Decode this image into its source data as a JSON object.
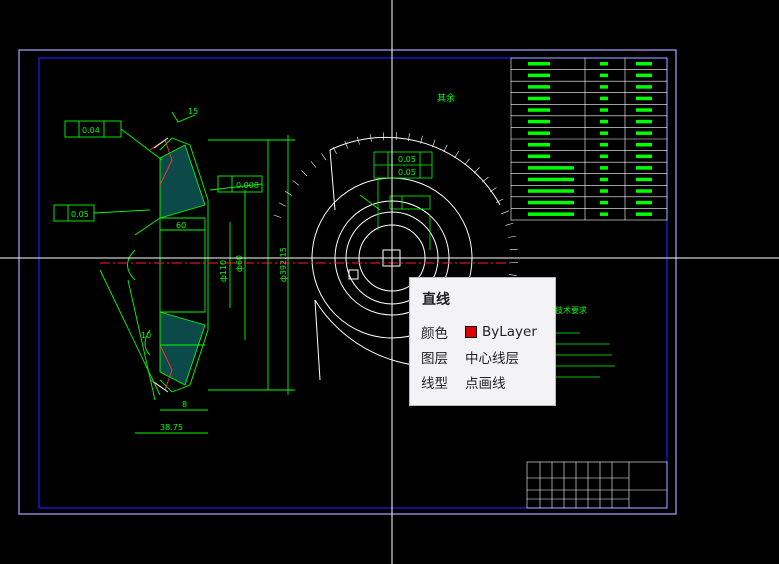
{
  "drawing": {
    "tech_heading": "技术要求",
    "surface_roughness_note": "其余",
    "tol_boxes": [
      {
        "symbol": "↗",
        "value": "0.04",
        "ref": "A"
      },
      {
        "symbol": "↗",
        "value": "0.05",
        "ref": "A"
      },
      {
        "symbol": "◻",
        "value": "0.008"
      },
      {
        "symbol": "⊥",
        "value": "0.05",
        "ref": "A"
      },
      {
        "symbol": "∥",
        "value": "0.05",
        "ref": "A"
      }
    ],
    "dims": [
      "15",
      "60",
      "10",
      "8",
      "38.75",
      "ф110",
      "ф60",
      "ф392.15"
    ]
  },
  "tooltip": {
    "title": "直线",
    "rows": [
      {
        "key": "颜色",
        "value": "ByLayer",
        "color": "#e00000"
      },
      {
        "key": "图层",
        "value": "中心线层"
      },
      {
        "key": "线型",
        "value": "点画线"
      }
    ]
  },
  "colors": {
    "background": "#000000",
    "geometry": "#00ff00",
    "border_outer": "#a6a6ff",
    "border_inner": "#0000ff",
    "center_line": "#ff0000",
    "crosshair": "#ffffff",
    "title_block_text": "#ff00ff"
  }
}
